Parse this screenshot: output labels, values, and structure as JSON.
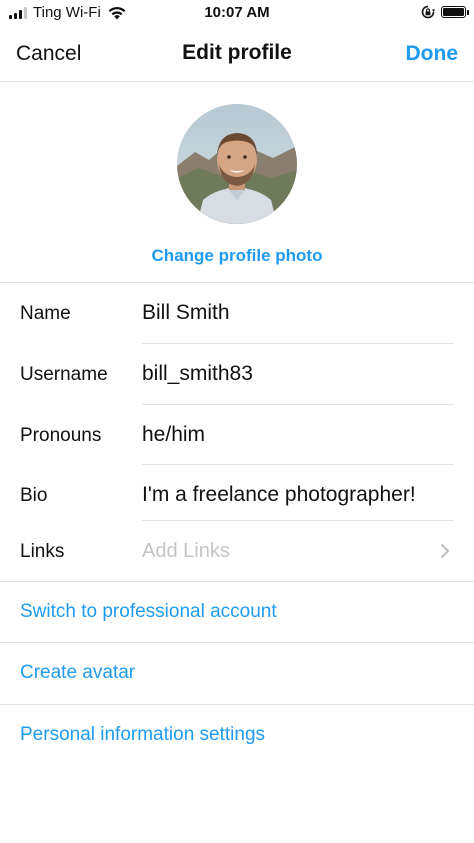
{
  "status_bar": {
    "carrier": "Ting Wi-Fi",
    "time": "10:07 AM",
    "icons": [
      "signal-icon",
      "wifi-icon",
      "rotation-lock-icon",
      "battery-icon"
    ]
  },
  "nav": {
    "cancel_label": "Cancel",
    "title": "Edit profile",
    "done_label": "Done"
  },
  "profile": {
    "change_photo_label": "Change profile photo"
  },
  "fields": [
    {
      "label": "Name",
      "value": "Bill Smith"
    },
    {
      "label": "Username",
      "value": "bill_smith83"
    },
    {
      "label": "Pronouns",
      "value": "he/him"
    },
    {
      "label": "Bio",
      "value": "I'm a freelance photographer!"
    },
    {
      "label": "Links",
      "placeholder": "Add Links"
    }
  ],
  "links": {
    "professional": "Switch to professional account",
    "avatar": "Create avatar",
    "personal_info": "Personal information settings"
  },
  "colors": {
    "accent": "#1e9bf0",
    "separator": "#e3e3e3",
    "placeholder": "#c4c4c4"
  }
}
